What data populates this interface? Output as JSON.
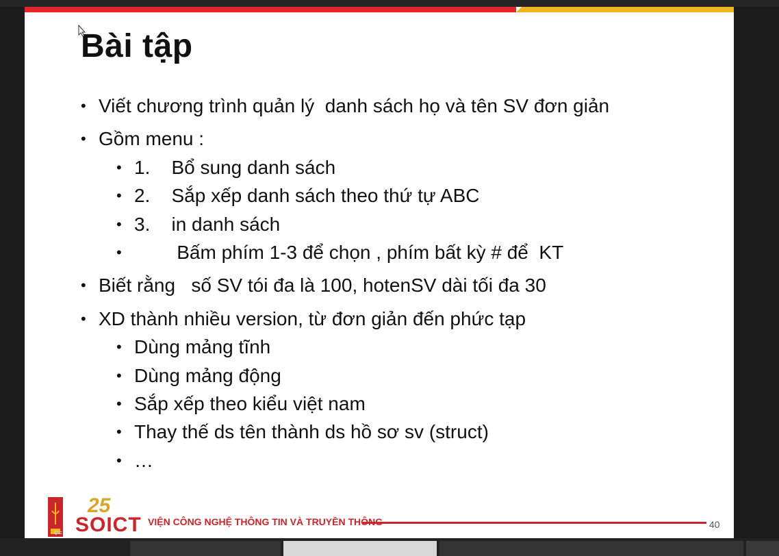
{
  "slide": {
    "title": "Bài tập",
    "page_number": "40",
    "footer_text": "VIỆN CÔNG NGHỆ THÔNG TIN VÀ TRUYỀN THÔNG",
    "logo_number": "25",
    "logo_text": "SOICT",
    "left_arrow": "⇐"
  },
  "bullets": {
    "item1": "Viết chương trình quản lý  danh sách họ và tên SV đơn giản",
    "item2": "Gồm menu :",
    "item2_sub1": "1.    Bổ sung danh sách",
    "item2_sub2": "2.    Sắp xếp danh sách theo thứ tự ABC",
    "item2_sub3": "3.    in danh sách",
    "item2_sub4": "        Bấm phím 1-3 để chọn , phím bất kỳ # để  KT",
    "item3": "Biết rằng   số SV tói đa là 100, hotenSV dài tối đa 30",
    "item4": "XD thành nhiều version, từ đơn giản đến phức tạp",
    "item4_sub1": "Dùng mảng tĩnh",
    "item4_sub2": "Dùng mảng động",
    "item4_sub3": "Sắp xếp theo kiểu việt nam",
    "item4_sub4": "Thay thế ds tên thành ds hồ sơ sv (struct)",
    "item4_sub5": "…",
    "bullet_char": "•"
  },
  "colors": {
    "accent_red": "#e5262a",
    "accent_yellow": "#f2b51f",
    "footer_red": "#c9252b"
  }
}
